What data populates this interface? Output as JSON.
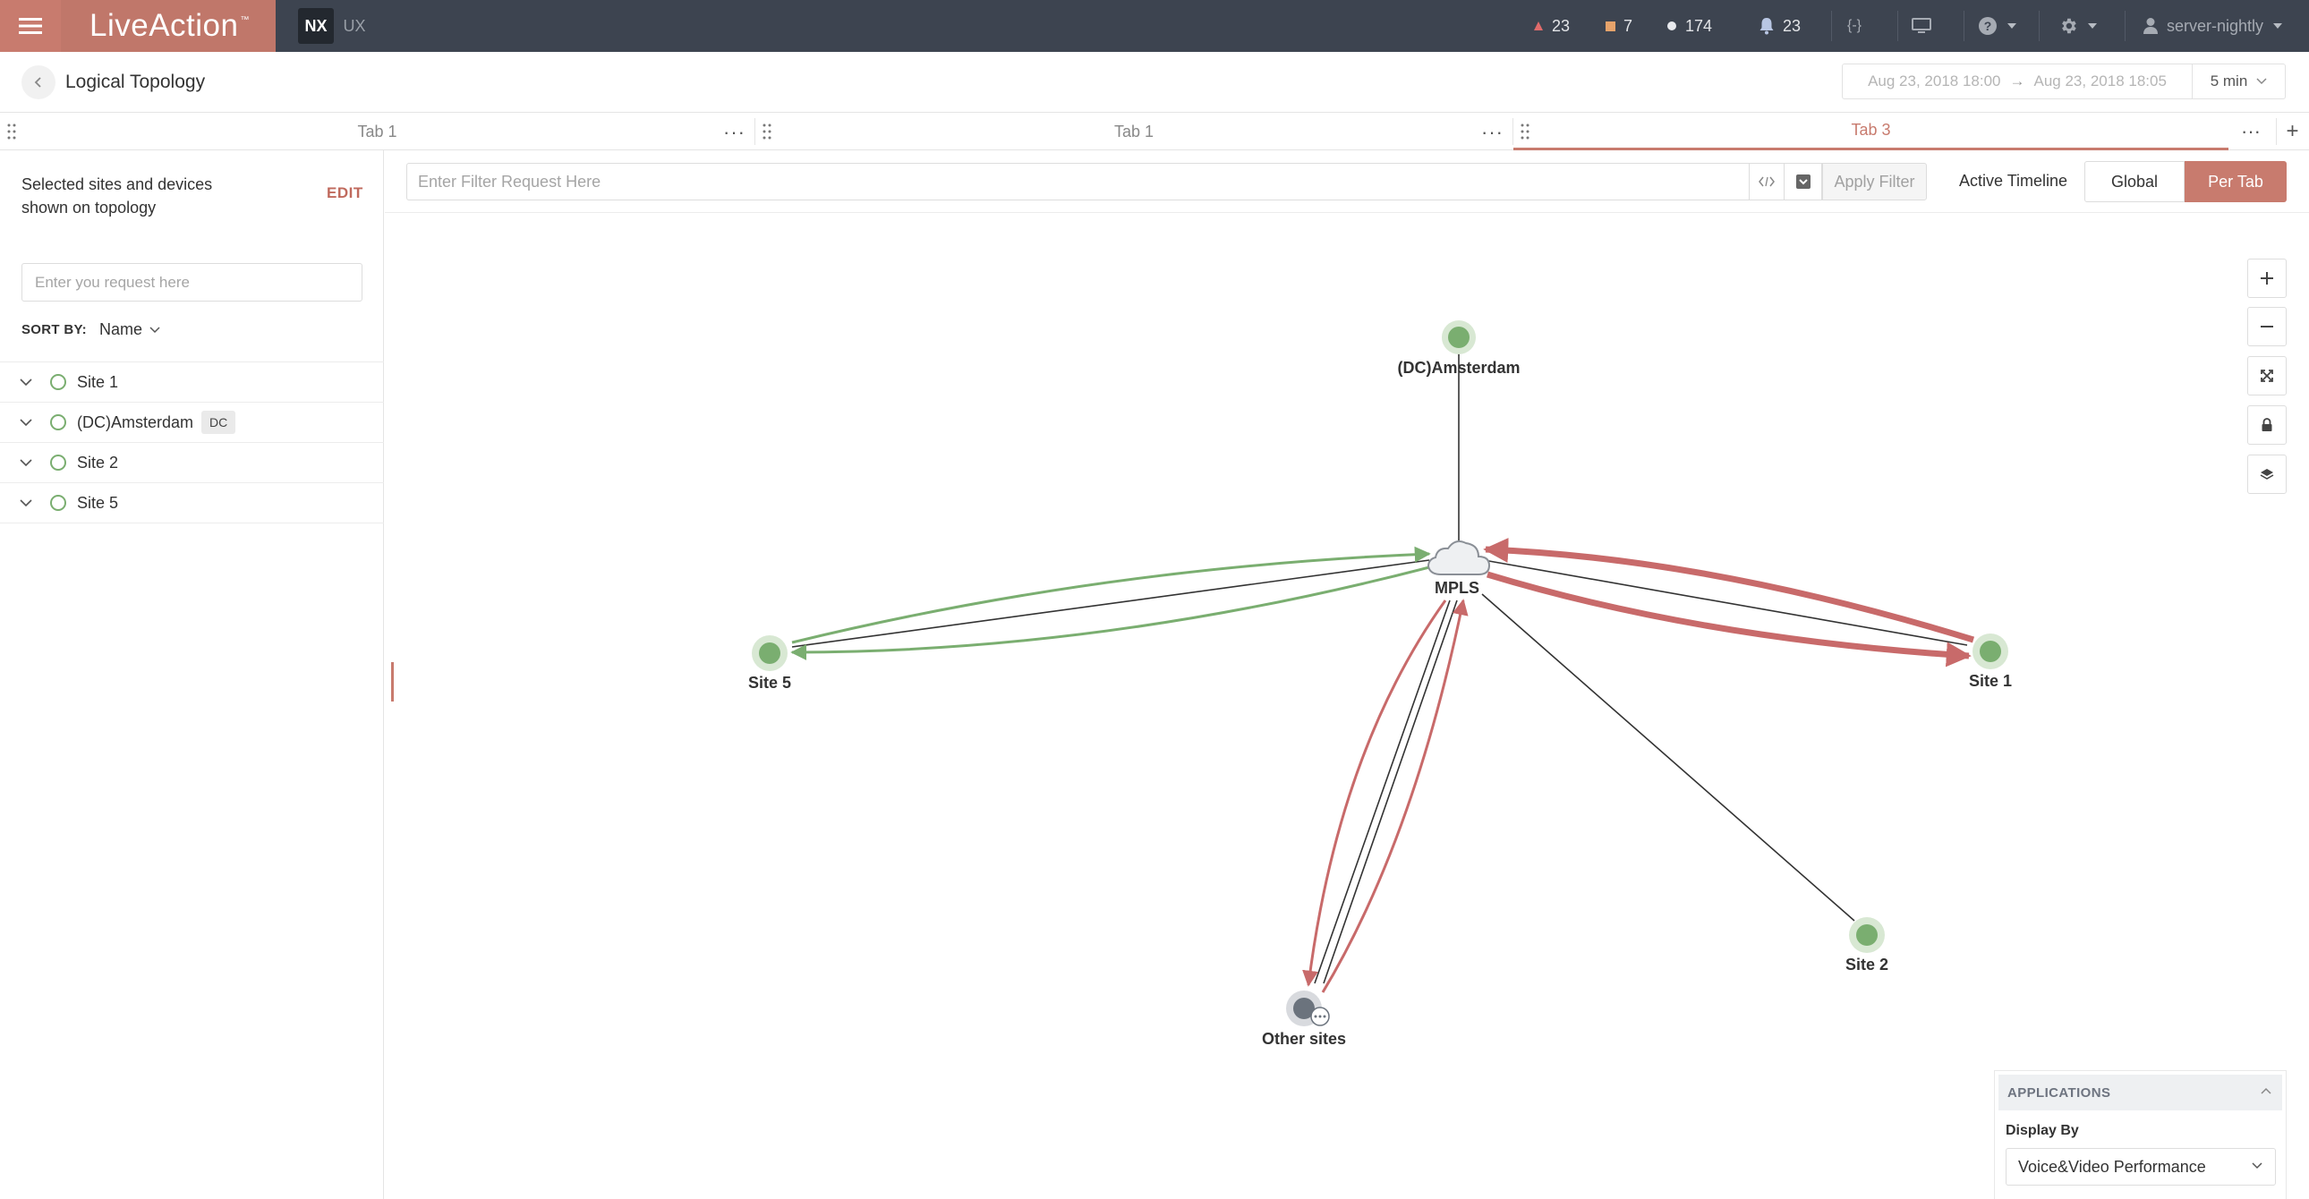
{
  "app": {
    "brand": "LiveAction",
    "trademark": "™",
    "modes": {
      "active": "NX",
      "inactive": "UX"
    }
  },
  "topbar": {
    "alerts_critical": "23",
    "alerts_warning": "7",
    "alerts_info": "174",
    "notifications": "23",
    "code_icon": "{-}",
    "user": "server-nightly"
  },
  "header": {
    "title": "Logical Topology",
    "date_from": "Aug 23, 2018 18:00",
    "date_arrow": "→",
    "date_to": "Aug 23, 2018 18:05",
    "interval": "5 min"
  },
  "tabs": [
    {
      "label": "Tab 1",
      "active": false
    },
    {
      "label": "Tab 1",
      "active": false
    },
    {
      "label": "Tab 3",
      "active": true
    }
  ],
  "tab_more": "···",
  "tab_add": "+",
  "sidebar": {
    "caption": "Selected sites and devices shown on topology",
    "edit": "EDIT",
    "search_placeholder": "Enter you request here",
    "sort_label": "SORT BY:",
    "sort_value": "Name",
    "items": [
      {
        "label": "Site 1",
        "tag": ""
      },
      {
        "label": "(DC)Amsterdam",
        "tag": "DC"
      },
      {
        "label": "Site 2",
        "tag": ""
      },
      {
        "label": "Site 5",
        "tag": ""
      }
    ]
  },
  "filter": {
    "placeholder": "Enter Filter Request Here",
    "apply": "Apply Filter",
    "active_timeline": "Active Timeline",
    "global": "Global",
    "per_tab": "Per Tab"
  },
  "topology": {
    "nodes": {
      "amsterdam": "(DC)Amsterdam",
      "mpls": "MPLS",
      "site5": "Site 5",
      "site1": "Site 1",
      "site2": "Site 2",
      "other": "Other sites"
    },
    "colors": {
      "good": "#7aae70",
      "bad": "#c86a6a",
      "neutral": "#333333"
    }
  },
  "applications_panel": {
    "title": "APPLICATIONS",
    "display_by_label": "Display By",
    "display_by_value": "Voice&Video Performance"
  },
  "colors": {
    "accent": "#c87b6e",
    "topbar": "#3d4450",
    "alert_critical": "#e06b6b",
    "alert_warning": "#e6a36b",
    "alert_info": "#ffffff"
  }
}
